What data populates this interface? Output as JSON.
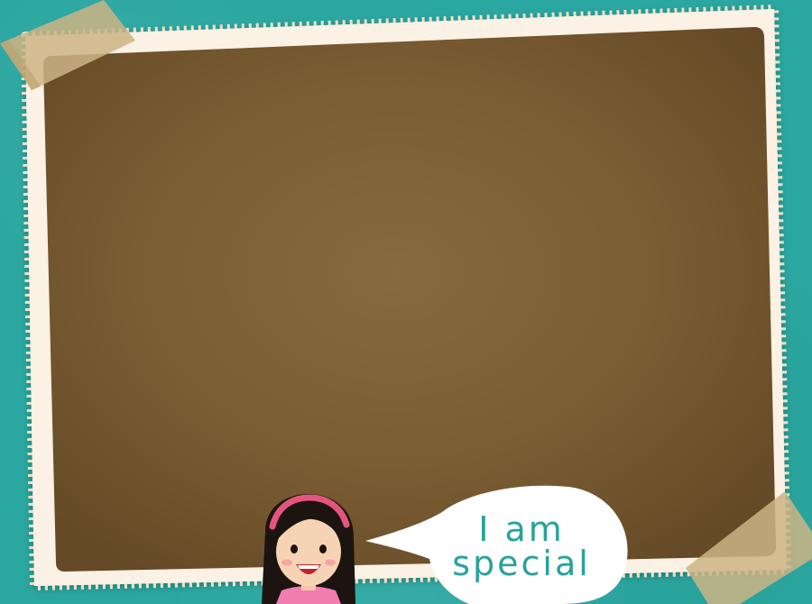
{
  "speech_bubble": {
    "line1": "I am",
    "line2": "special"
  },
  "colors": {
    "background": "#2aa7a0",
    "frame": "#fbf1e4",
    "board_center": "#876a3d",
    "board_edge": "#6a4e2a",
    "tape": "#cdb485",
    "text_accent": "#26a39c"
  },
  "icons": {
    "character": "girl-with-pink-headband-icon",
    "tape": "masking-tape-icon"
  }
}
